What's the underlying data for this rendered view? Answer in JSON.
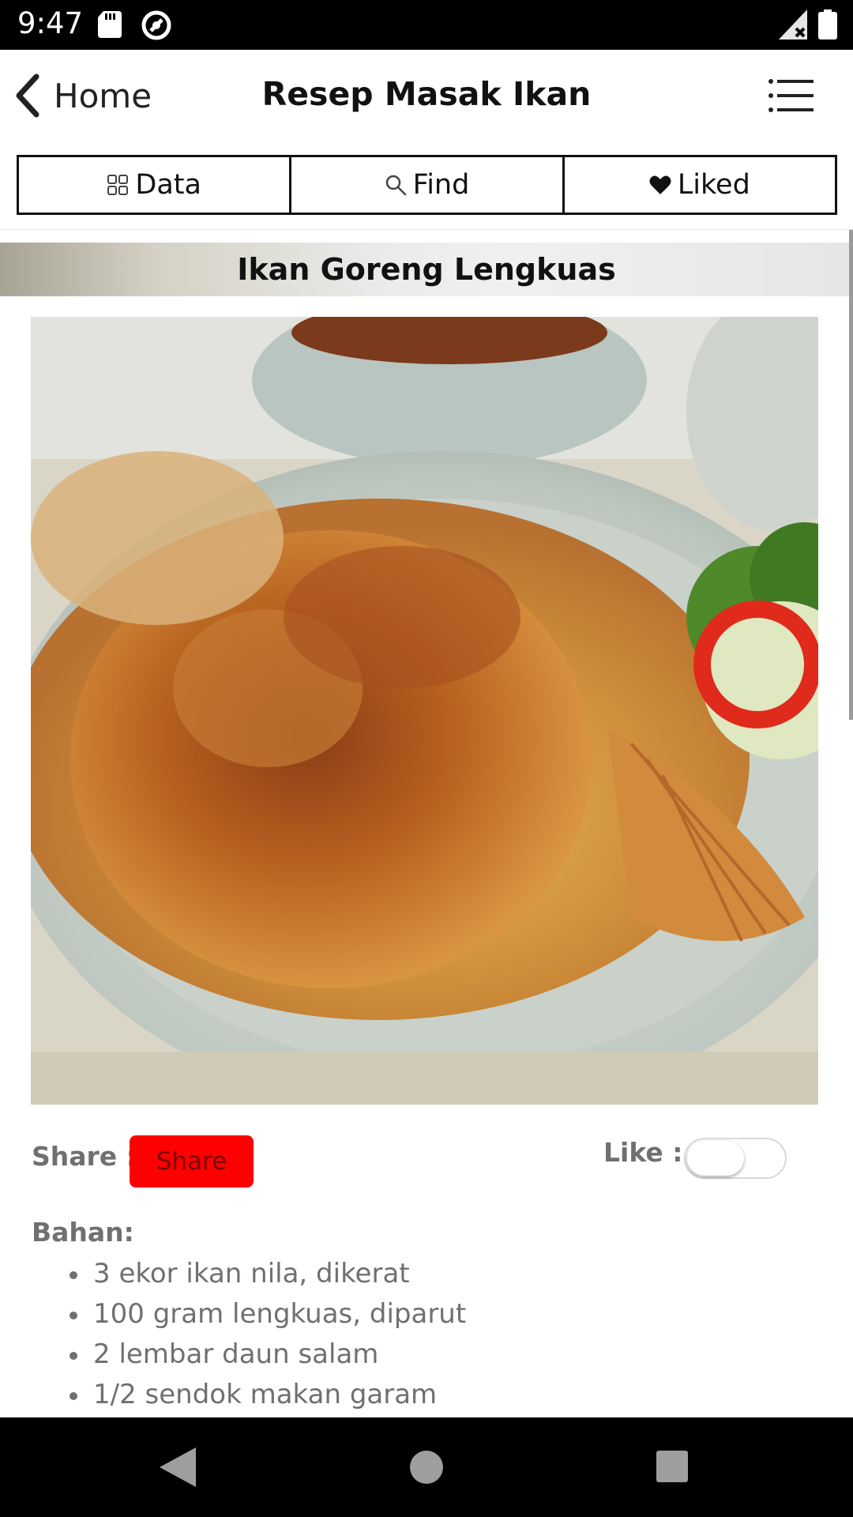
{
  "status_bar": {
    "time": "9:47",
    "icons": [
      "sd-card-icon",
      "at-sign-icon",
      "signal-icon",
      "battery-icon"
    ]
  },
  "header": {
    "back_label": "Home",
    "title": "Resep Masak Ikan",
    "menu_icon": "list-menu-icon"
  },
  "tabs": [
    {
      "label": "Data",
      "icon": "grid-icon"
    },
    {
      "label": "Find",
      "icon": "search-icon"
    },
    {
      "label": "Liked",
      "icon": "heart-icon"
    }
  ],
  "recipe": {
    "title": "Ikan Goreng Lengkuas",
    "image_alt": "fried-fish-photo",
    "share_label": "Share :",
    "share_button": "Share",
    "like_label": "Like :",
    "like_on": false,
    "ingredients_heading": "Bahan:",
    "ingredients": [
      "3 ekor ikan nila, dikerat",
      "100 gram lengkuas, diparut",
      "2 lembar daun salam",
      "1/2 sendok makan garam"
    ]
  },
  "colors": {
    "share_button_bg": "#ff0000",
    "muted_text": "#707070",
    "status_bar_bg": "#000000"
  }
}
